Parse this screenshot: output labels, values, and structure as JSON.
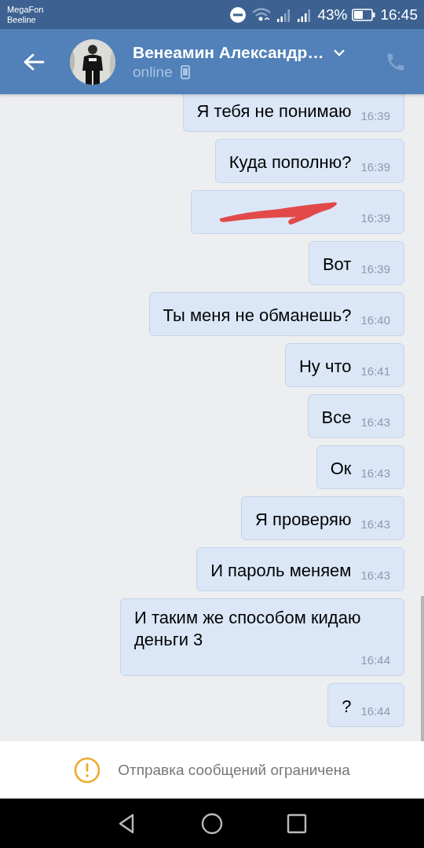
{
  "status_bar": {
    "carrier_1": "MegaFon",
    "carrier_2": "Beeline",
    "battery": "43%",
    "time": "16:45"
  },
  "header": {
    "name": "Венеамин Александр…",
    "status": "online"
  },
  "messages": [
    {
      "kind": "text",
      "text": "Я тебя не понимаю",
      "time": "16:39"
    },
    {
      "kind": "text",
      "text": "Куда пополню?",
      "time": "16:39"
    },
    {
      "kind": "redacted",
      "time": "16:39"
    },
    {
      "kind": "text",
      "text": "Вот",
      "time": "16:39"
    },
    {
      "kind": "text",
      "text": "Ты меня не обманешь?",
      "time": "16:40"
    },
    {
      "kind": "text",
      "text": "Ну что",
      "time": "16:41"
    },
    {
      "kind": "text",
      "text": "Все",
      "time": "16:43"
    },
    {
      "kind": "text",
      "text": "Ок",
      "time": "16:43"
    },
    {
      "kind": "text",
      "text": "Я проверяю",
      "time": "16:43"
    },
    {
      "kind": "text",
      "text": "И пароль меняем",
      "time": "16:43"
    },
    {
      "kind": "text",
      "text": "И таким же способом кидаю деньги 3",
      "time": "16:44"
    },
    {
      "kind": "text",
      "text": "?",
      "time": "16:44"
    }
  ],
  "notice": {
    "text": "Отправка сообщений ограничена"
  }
}
